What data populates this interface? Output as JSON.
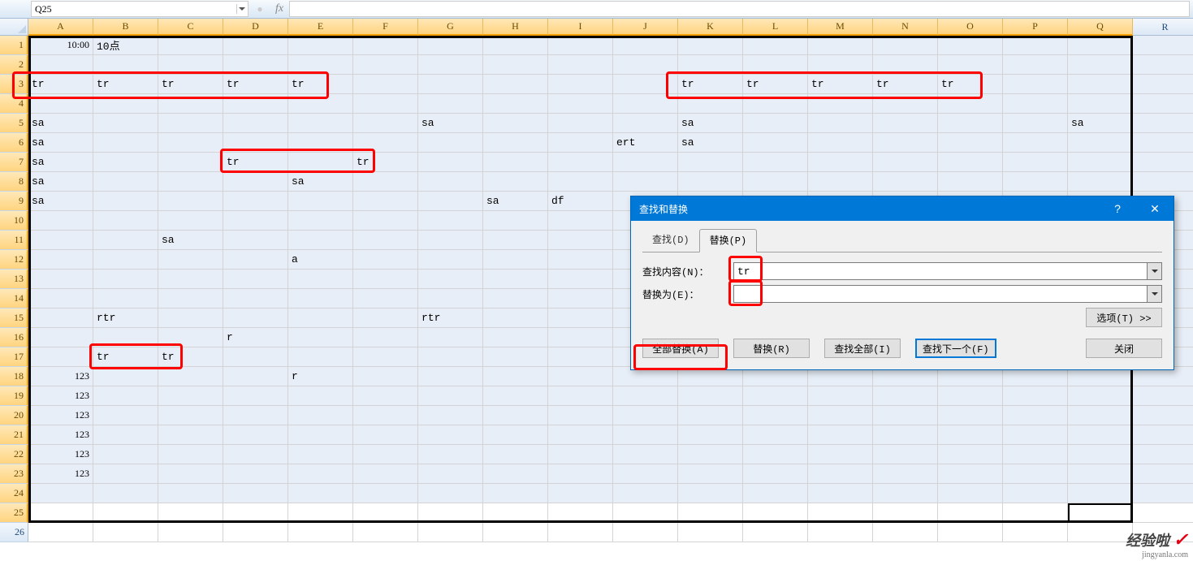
{
  "formula_bar": {
    "name_box": "Q25",
    "fx_label": "fx",
    "formula": ""
  },
  "columns": [
    "A",
    "B",
    "C",
    "D",
    "E",
    "F",
    "G",
    "H",
    "I",
    "J",
    "K",
    "L",
    "M",
    "N",
    "O",
    "P",
    "Q",
    "R"
  ],
  "rows": [
    "1",
    "2",
    "3",
    "4",
    "5",
    "6",
    "7",
    "8",
    "9",
    "10",
    "11",
    "12",
    "13",
    "14",
    "15",
    "16",
    "17",
    "18",
    "19",
    "20",
    "21",
    "22",
    "23",
    "24",
    "25",
    "26"
  ],
  "cells": {
    "1": {
      "A": "10:00",
      "B": "10点"
    },
    "3": {
      "A": "tr",
      "B": "tr",
      "C": "tr",
      "D": "tr",
      "E": "tr",
      "K": "tr",
      "L": "tr",
      "M": "tr",
      "N": "tr",
      "O": "tr"
    },
    "5": {
      "A": "sa",
      "G": "sa",
      "K": "sa",
      "Q": "sa"
    },
    "6": {
      "A": "sa",
      "J": "ert",
      "K": "sa"
    },
    "7": {
      "A": "sa",
      "D": "tr",
      "F": "tr"
    },
    "8": {
      "A": "sa",
      "E": "sa"
    },
    "9": {
      "A": "sa",
      "H": "sa",
      "I": "df"
    },
    "11": {
      "C": "sa"
    },
    "12": {
      "E": "a"
    },
    "15": {
      "B": "rtr",
      "G": "rtr"
    },
    "16": {
      "D": "r"
    },
    "17": {
      "B": "tr",
      "C": "tr"
    },
    "18": {
      "A": "123",
      "E": "r"
    },
    "19": {
      "A": "123"
    },
    "20": {
      "A": "123"
    },
    "21": {
      "A": "123"
    },
    "22": {
      "A": "123"
    },
    "23": {
      "A": "123"
    }
  },
  "numeric_cols": [
    "A"
  ],
  "numeric_rows_for_A": [
    "18",
    "19",
    "20",
    "21",
    "22",
    "23"
  ],
  "cellA1_numeric": true,
  "dialog": {
    "title": "查找和替换",
    "help": "?",
    "close": "✕",
    "tab_find": "查找(D)",
    "tab_replace": "替换(P)",
    "find_label": "查找内容(N)：",
    "find_value": "tr",
    "replace_label": "替换为(E)：",
    "replace_value": "",
    "options_btn": "选项(T) >>",
    "btn_replace_all": "全部替换(A)",
    "btn_replace": "替换(R)",
    "btn_find_all": "查找全部(I)",
    "btn_find_next": "查找下一个(F)",
    "btn_close": "关闭"
  },
  "watermark": {
    "text": "经验啦",
    "check": "✓",
    "url": "jingyanla.com"
  }
}
